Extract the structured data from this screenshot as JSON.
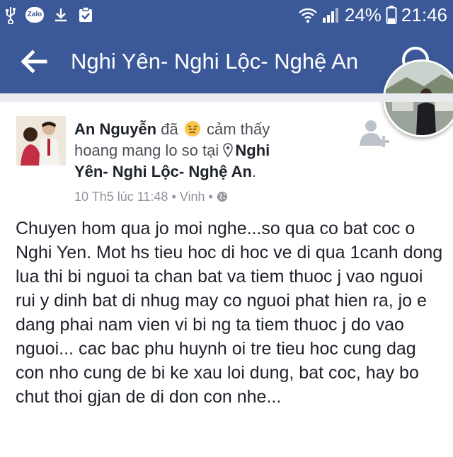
{
  "status_bar": {
    "icons": [
      "usb-icon",
      "zalo-icon",
      "download-icon",
      "clipboard-check-icon"
    ],
    "zalo_label": "Zalo",
    "battery_percent": "24%",
    "time": "21:46",
    "right_icons": [
      "wifi-icon",
      "signal-icon",
      "battery-icon"
    ]
  },
  "header": {
    "title": "Nghi Yên- Nghi Lộc- Nghệ An",
    "back_icon": "arrow-left-icon",
    "search_icon": "search-icon"
  },
  "post": {
    "author": "An Nguyễn",
    "verb_prefix": "đã",
    "feeling": "cảm thấy hoang mang lo so",
    "at_word": "tại",
    "place": "Nghi Yên- Nghi Lộc- Nghệ An",
    "period": ".",
    "timestamp": "10 Th5 lúc 11:48",
    "separator": "•",
    "location_short": "Vinh",
    "privacy_icon": "globe-icon",
    "body": "Chuyen hom qua jo moi nghe...so qua co bat coc o Nghi Yen. Mot hs tieu hoc di hoc ve di qua 1canh dong lua thi bi nguoi ta chan bat va tiem thuoc j vao nguoi rui y dinh bat di nhug may co nguoi phat hien ra, jo e dang phai nam vien vi bi ng ta tiem thuoc j do vao nguoi... cac bac phu huynh oi tre tieu hoc cung dag con nho cung de bi ke xau loi dung, bat coc, hay bo chut thoi gjan de di don con nhe..."
  },
  "colors": {
    "facebook_blue": "#3b5998",
    "text": "#1d2129",
    "meta_gray": "#90949c",
    "background": "#ffffff"
  }
}
